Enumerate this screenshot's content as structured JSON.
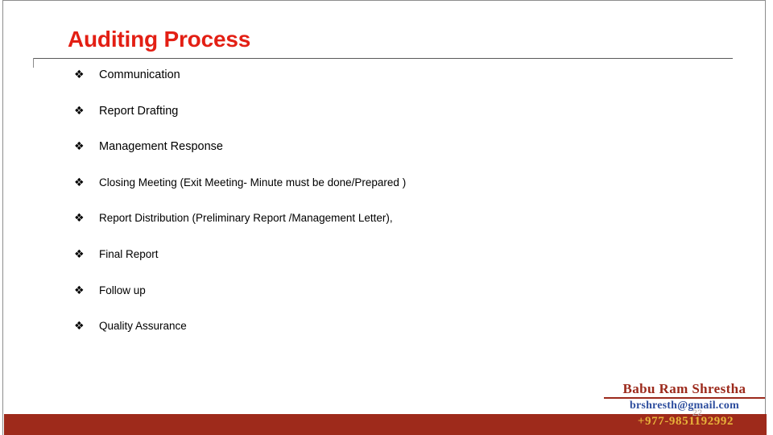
{
  "slide": {
    "title": "Auditing Process",
    "title_color": "#E31F14",
    "background_color": "#FFFFFF",
    "footer_bar_color": "#9E2A1B",
    "frame_line_color": "#595959"
  },
  "bullets": {
    "marker_glyph": "❖",
    "marker_name": "diamond-bullet-icon",
    "items": [
      {
        "text": "Communication"
      },
      {
        "text": "Report Drafting"
      },
      {
        "text": "Management Response"
      },
      {
        "text": "Closing Meeting (Exit Meeting- Minute must be done/Prepared )"
      },
      {
        "text": "Report Distribution  (Preliminary Report /Management Letter),"
      },
      {
        "text": "Final Report"
      },
      {
        "text": "Follow up"
      },
      {
        "text": "Quality Assurance"
      }
    ]
  },
  "signature": {
    "name": "Babu Ram Shrestha",
    "name_color": "#9C2A1C",
    "email": "brshresth@gmail.com",
    "email_color": "#2E4E9E",
    "phone": "+977-9851192992",
    "phone_color": "#E8B33A"
  },
  "footer": {
    "slide_number": "22"
  }
}
